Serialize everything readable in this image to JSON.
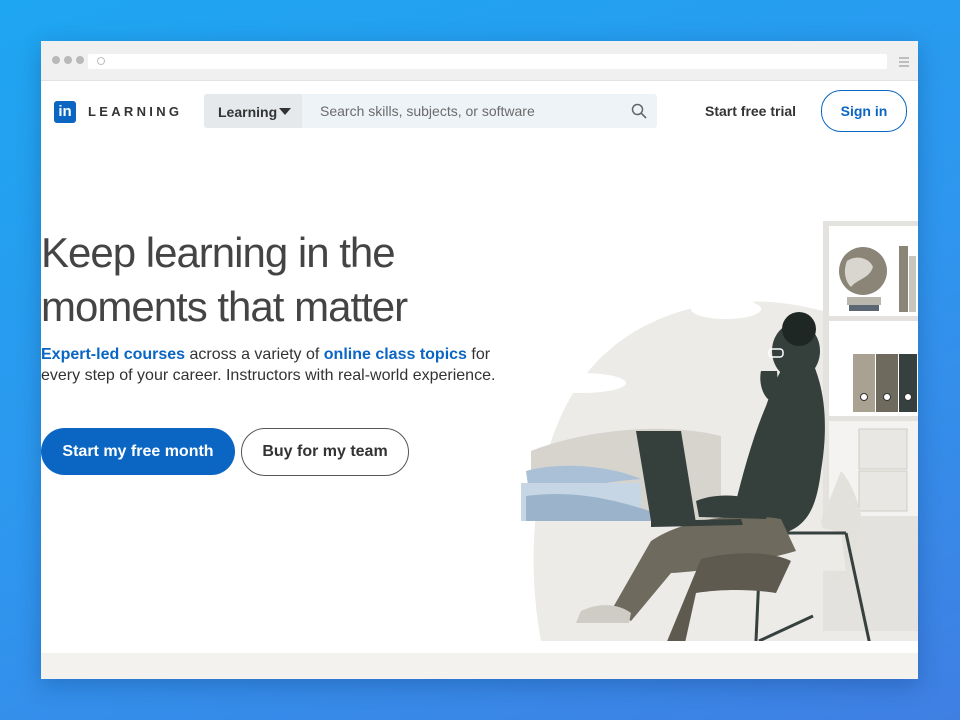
{
  "header": {
    "logo_mark": "in",
    "logo_text": "LEARNING",
    "search_dropdown_label": "Learning",
    "search_placeholder": "Search skills, subjects, or software",
    "start_trial_label": "Start free trial",
    "sign_in_label": "Sign in"
  },
  "hero": {
    "title_line1": "Keep learning in the",
    "title_line2": "moments that matter",
    "desc_link1": "Expert-led courses",
    "desc_text1": " across a variety of ",
    "desc_link2": "online class topics",
    "desc_text2": " for every step of your career. Instructors with real-world experience.",
    "primary_cta": "Start my free month",
    "secondary_cta": "Buy for my team"
  },
  "icons": {
    "browser_menu": "hamburger-icon",
    "search": "search-icon",
    "dropdown": "caret-down-icon"
  },
  "colors": {
    "brand_blue": "#0a66c2",
    "background_gradient_start": "#1ea6f2",
    "background_gradient_end": "#3f7fe3"
  }
}
